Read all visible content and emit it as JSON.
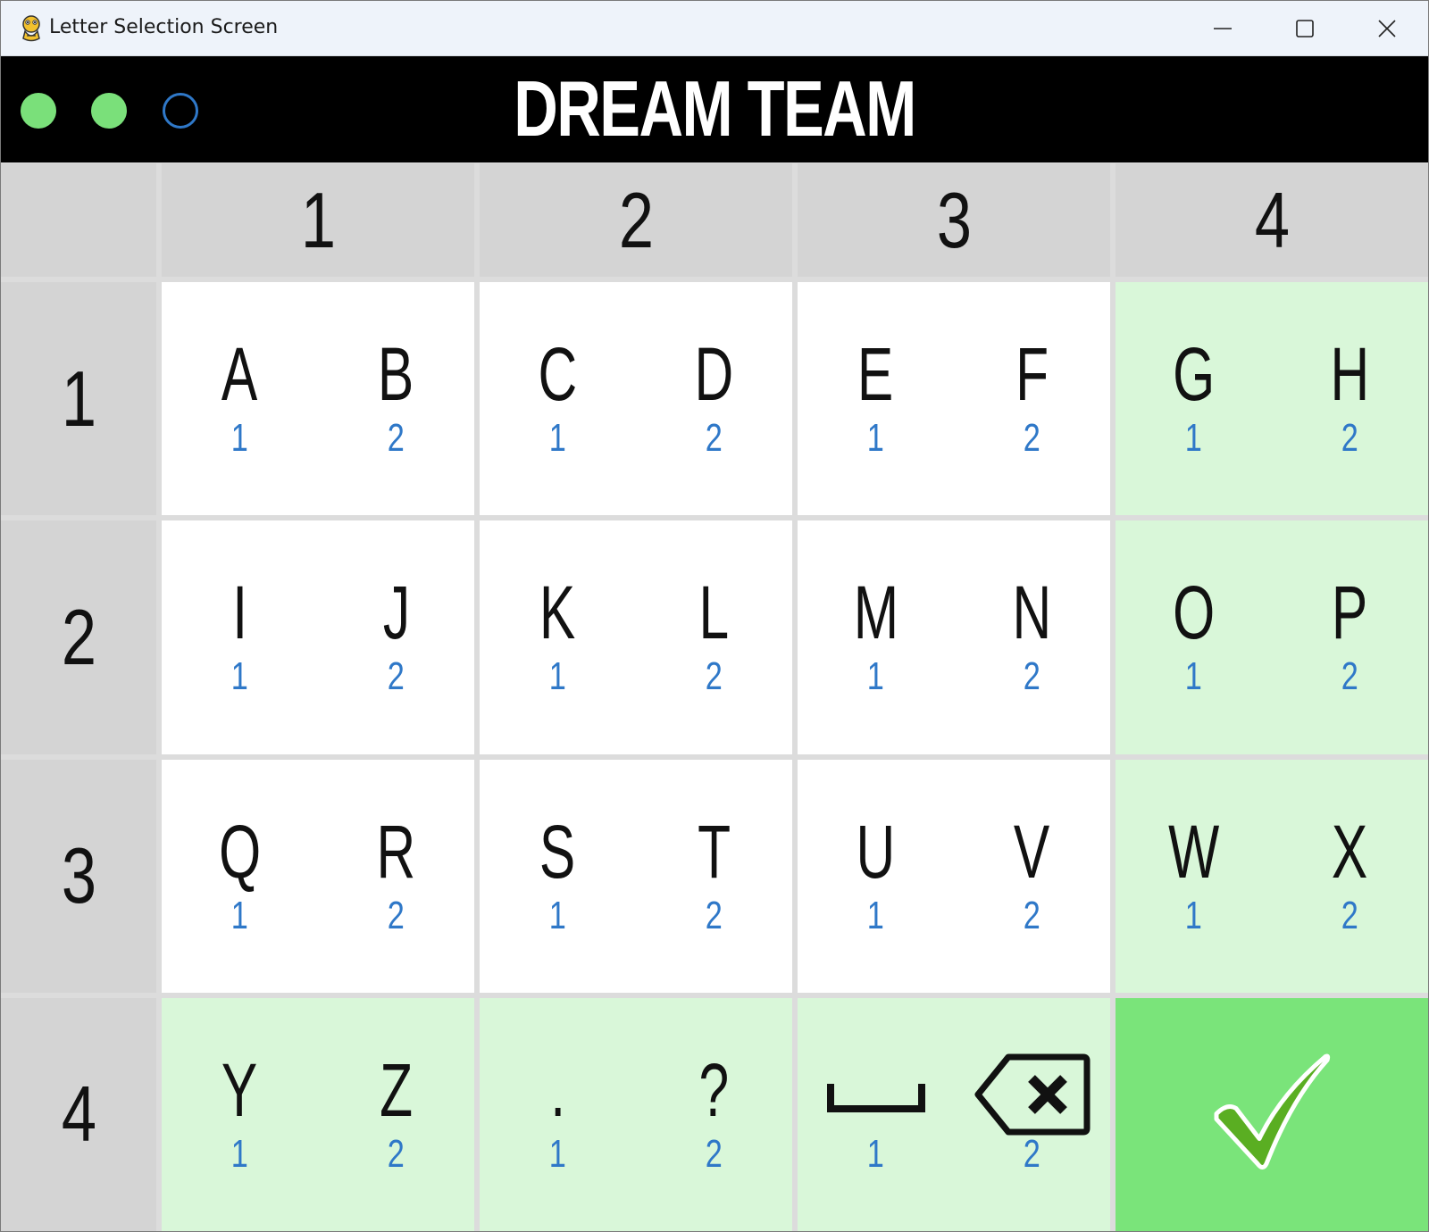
{
  "window": {
    "title": "Letter Selection Screen",
    "icon": "python-snake-icon"
  },
  "header": {
    "team_name": "DREAM TEAM",
    "progress_dots": [
      {
        "state": "filled",
        "color": "#7ae07a"
      },
      {
        "state": "filled",
        "color": "#7ae07a"
      },
      {
        "state": "empty",
        "color": "#2f78c8"
      }
    ]
  },
  "columns": [
    "1",
    "2",
    "3",
    "4"
  ],
  "rows": [
    {
      "label": "1",
      "cells": [
        {
          "highlight": false,
          "items": [
            {
              "char": "A",
              "num": "1"
            },
            {
              "char": "B",
              "num": "2"
            }
          ]
        },
        {
          "highlight": false,
          "items": [
            {
              "char": "C",
              "num": "1"
            },
            {
              "char": "D",
              "num": "2"
            }
          ]
        },
        {
          "highlight": false,
          "items": [
            {
              "char": "E",
              "num": "1"
            },
            {
              "char": "F",
              "num": "2"
            }
          ]
        },
        {
          "highlight": true,
          "items": [
            {
              "char": "G",
              "num": "1"
            },
            {
              "char": "H",
              "num": "2"
            }
          ]
        }
      ]
    },
    {
      "label": "2",
      "cells": [
        {
          "highlight": false,
          "items": [
            {
              "char": "I",
              "num": "1"
            },
            {
              "char": "J",
              "num": "2"
            }
          ]
        },
        {
          "highlight": false,
          "items": [
            {
              "char": "K",
              "num": "1"
            },
            {
              "char": "L",
              "num": "2"
            }
          ]
        },
        {
          "highlight": false,
          "items": [
            {
              "char": "M",
              "num": "1"
            },
            {
              "char": "N",
              "num": "2"
            }
          ]
        },
        {
          "highlight": true,
          "items": [
            {
              "char": "O",
              "num": "1"
            },
            {
              "char": "P",
              "num": "2"
            }
          ]
        }
      ]
    },
    {
      "label": "3",
      "cells": [
        {
          "highlight": false,
          "items": [
            {
              "char": "Q",
              "num": "1"
            },
            {
              "char": "R",
              "num": "2"
            }
          ]
        },
        {
          "highlight": false,
          "items": [
            {
              "char": "S",
              "num": "1"
            },
            {
              "char": "T",
              "num": "2"
            }
          ]
        },
        {
          "highlight": false,
          "items": [
            {
              "char": "U",
              "num": "1"
            },
            {
              "char": "V",
              "num": "2"
            }
          ]
        },
        {
          "highlight": true,
          "items": [
            {
              "char": "W",
              "num": "1"
            },
            {
              "char": "X",
              "num": "2"
            }
          ]
        }
      ]
    },
    {
      "label": "4",
      "cells": [
        {
          "highlight": true,
          "items": [
            {
              "char": "Y",
              "num": "1"
            },
            {
              "char": "Z",
              "num": "2"
            }
          ]
        },
        {
          "highlight": true,
          "items": [
            {
              "char": ".",
              "num": "1"
            },
            {
              "char": "?",
              "num": "2"
            }
          ]
        },
        {
          "highlight": true,
          "items": [
            {
              "icon": "space-bar-icon",
              "num": "1"
            },
            {
              "icon": "backspace-icon",
              "num": "2"
            }
          ]
        },
        {
          "confirm": true,
          "icon": "checkmark-icon"
        }
      ]
    }
  ],
  "colors": {
    "highlight": "#d9f7d9",
    "confirm": "#7ae47a",
    "number_blue": "#2f78c8",
    "check_green": "#5aae22"
  }
}
